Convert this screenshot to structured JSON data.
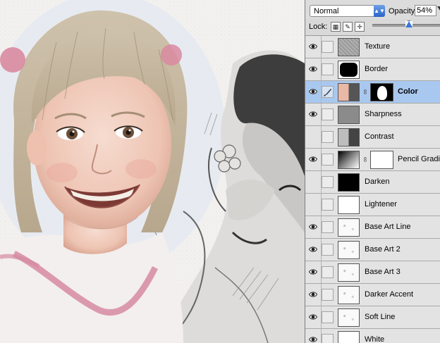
{
  "layers_panel": {
    "blend_mode": "Normal",
    "opacity_label": "Opacity:",
    "opacity_value": "54%",
    "opacity_fraction": 0.54,
    "lock_label": "Lock:",
    "lock_icons": [
      "lock-transparency-icon",
      "lock-pixels-icon",
      "lock-position-icon",
      "lock-all-icon"
    ],
    "layers": [
      {
        "name": "Texture",
        "visible": true,
        "thumb": "texture"
      },
      {
        "name": "Border",
        "visible": true,
        "thumb": "border"
      },
      {
        "name": "Color",
        "visible": true,
        "thumb": "photo",
        "mask": true,
        "selected": true
      },
      {
        "name": "Sharpness",
        "visible": true,
        "thumb": "gray"
      },
      {
        "name": "Contrast",
        "visible": false,
        "thumb": "photo-bw"
      },
      {
        "name": "Pencil Gradi...",
        "visible": true,
        "thumb": "gradient",
        "mask": true
      },
      {
        "name": "Darken",
        "visible": false,
        "thumb": "black"
      },
      {
        "name": "Lightener",
        "visible": false,
        "thumb": "white"
      },
      {
        "name": "Base Art Line",
        "visible": true,
        "thumb": "sketch"
      },
      {
        "name": "Base Art 2",
        "visible": true,
        "thumb": "sketch"
      },
      {
        "name": "Base Art 3",
        "visible": true,
        "thumb": "sketch"
      },
      {
        "name": "Darker Accent",
        "visible": true,
        "thumb": "sketch"
      },
      {
        "name": "Soft Line",
        "visible": true,
        "thumb": "sketch"
      },
      {
        "name": "White",
        "visible": true,
        "thumb": "white"
      }
    ]
  },
  "colors": {
    "selection": "#a9c8ef",
    "panel_bg": "#d6d6d6",
    "accent_blue": "#2b63c9"
  }
}
